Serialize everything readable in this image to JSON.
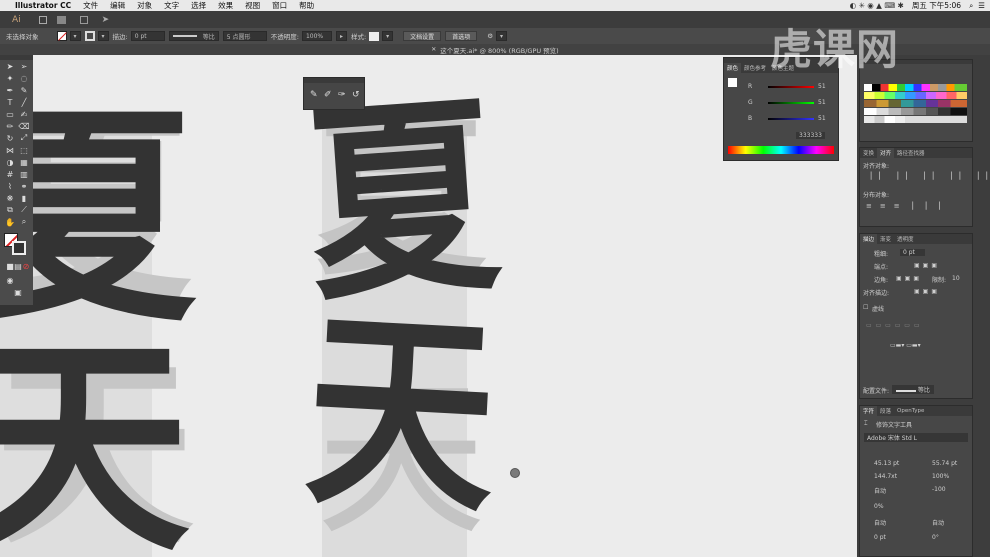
{
  "menubar": {
    "apple_icon": "apple-icon",
    "app_name": "Illustrator CC",
    "items": [
      "文件",
      "编辑",
      "对象",
      "文字",
      "选择",
      "效果",
      "视图",
      "窗口",
      "帮助"
    ],
    "clock": "周五 下午5:06"
  },
  "appbar": {
    "logo": "Ai"
  },
  "controlbar": {
    "selection_label": "未选择对象",
    "stroke_label": "描边:",
    "stroke_value": "0 pt",
    "uniform_label": "等比",
    "brush_label": "5 点圆形",
    "opacity_label": "不透明度:",
    "opacity_value": "100%",
    "style_label": "样式:",
    "doc_setup": "文档设置",
    "preferences": "首选项"
  },
  "document": {
    "tab_title": "这个夏天.ai* @ 800% (RGB/GPU 预览)"
  },
  "canvas": {
    "left_glyph_1": "夏",
    "left_glyph_2": "天",
    "center_glyph_1": "夏",
    "center_glyph_2": "天",
    "ghost_glyph_1": "夏",
    "ghost_glyph_2": "天"
  },
  "watermark": {
    "text": "虎课网"
  },
  "color_panel": {
    "tabs": [
      "颜色",
      "颜色参考",
      "颜色主题"
    ],
    "r_label": "R",
    "g_label": "G",
    "b_label": "B",
    "r_value": "51",
    "g_value": "51",
    "b_value": "51",
    "hex_value": "333333"
  },
  "align_panel": {
    "tabs": [
      "变换",
      "对齐",
      "路径查找器"
    ],
    "align_objects": "对齐对象:",
    "distribute_objects": "分布对象:"
  },
  "stroke_panel": {
    "tabs": [
      "描边",
      "渐变",
      "透明度"
    ],
    "weight_label": "粗细:",
    "weight_value": "0 pt",
    "cap_label": "端点:",
    "corner_label": "边角:",
    "limit_label": "限制:",
    "limit_value": "10",
    "align_label": "对齐描边:",
    "dashed_label": "虚线",
    "profile_label": "配置文件:",
    "profile_value": "等比"
  },
  "character_panel": {
    "tabs": [
      "字符",
      "段落",
      "OpenType"
    ],
    "touch_tool": "修饰文字工具",
    "font": "Adobe 宋体 Std L",
    "size": "45.13 pt",
    "leading": "55.74 pt",
    "vscale": "144.7xt",
    "hscale": "100%",
    "tracking": "自动",
    "kerning": "-100",
    "rotation": "0%",
    "auto_a": "自动",
    "auto_b": "自动",
    "baseline": "0 pt",
    "rotate": "0°"
  },
  "colors": {
    "menubar_bg": "#e9e9e9",
    "ui_dark": "#4a4a4a",
    "canvas_bg": "#ececec",
    "glyph_fill": "#333333",
    "ghost_fill": "#c8c8c8"
  }
}
